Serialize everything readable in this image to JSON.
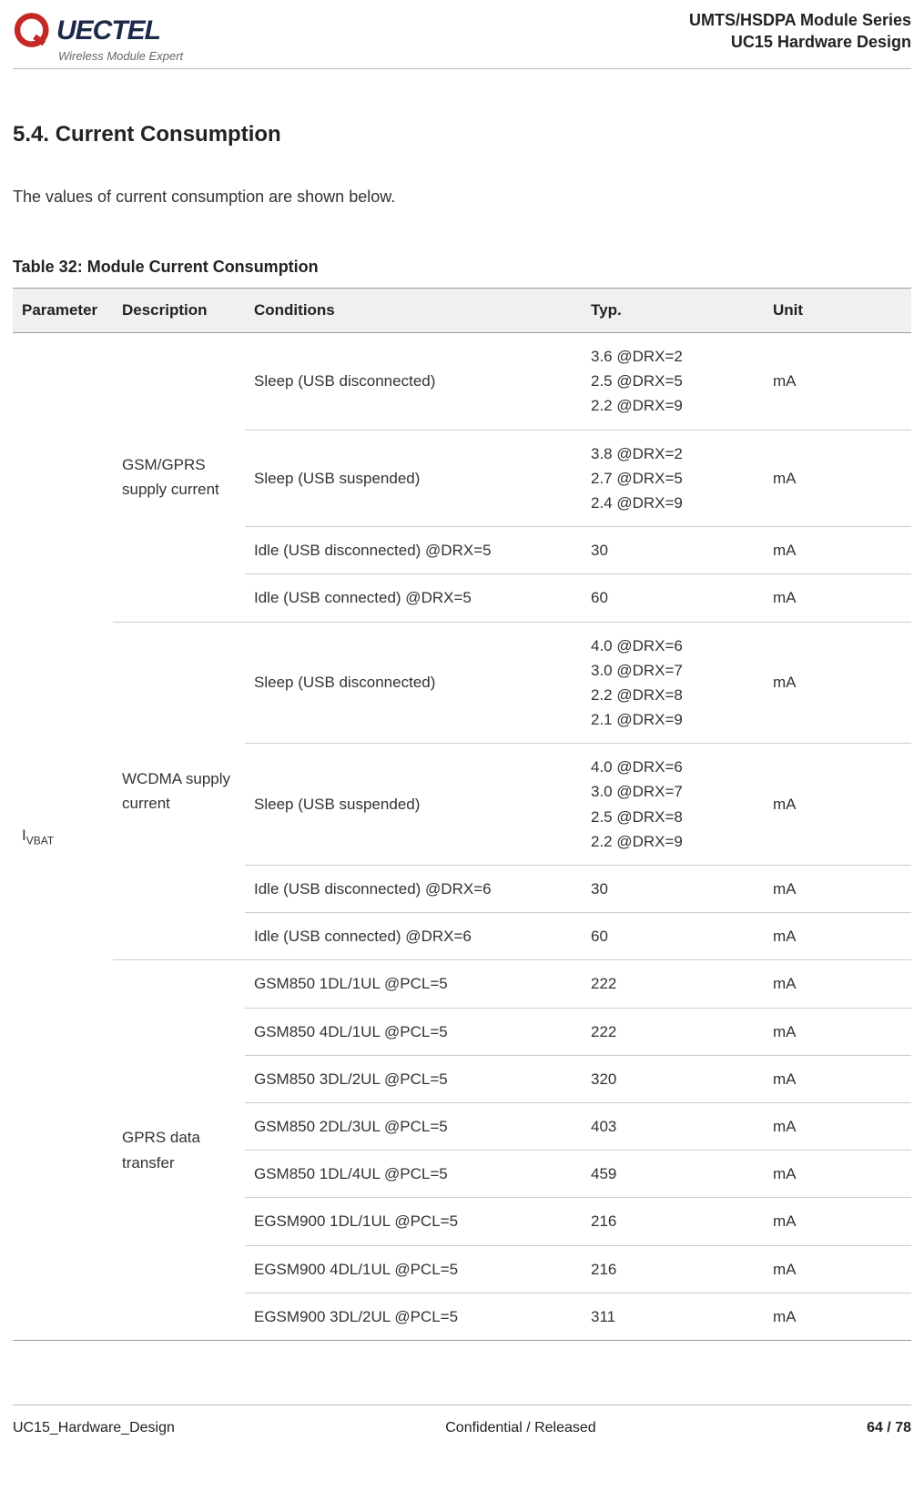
{
  "header": {
    "logo_text": "UECTEL",
    "logo_sub": "Wireless Module Expert",
    "series_line1": "UMTS/HSDPA Module Series",
    "series_line2": "UC15 Hardware Design"
  },
  "section": {
    "number_title": "5.4. Current Consumption",
    "intro": "The values of current consumption are shown below.",
    "table_caption": "Table 32: Module Current Consumption"
  },
  "table": {
    "headers": {
      "parameter": "Parameter",
      "description": "Description",
      "conditions": "Conditions",
      "typ": "Typ.",
      "unit": "Unit"
    },
    "parameter_base": "I",
    "parameter_sub": "VBAT",
    "groups": [
      {
        "description": "GSM/GPRS supply current",
        "rows": [
          {
            "conditions": "Sleep (USB disconnected)",
            "typ": [
              "3.6 @DRX=2",
              "2.5 @DRX=5",
              "2.2 @DRX=9"
            ],
            "unit": "mA"
          },
          {
            "conditions": "Sleep (USB suspended)",
            "typ": [
              "3.8 @DRX=2",
              "2.7 @DRX=5",
              "2.4 @DRX=9"
            ],
            "unit": "mA"
          },
          {
            "conditions": "Idle (USB disconnected) @DRX=5",
            "typ": [
              "30"
            ],
            "unit": "mA"
          },
          {
            "conditions": "Idle (USB connected) @DRX=5",
            "typ": [
              "60"
            ],
            "unit": "mA"
          }
        ]
      },
      {
        "description": "WCDMA supply current",
        "rows": [
          {
            "conditions": "Sleep (USB disconnected)",
            "typ": [
              "4.0 @DRX=6",
              "3.0 @DRX=7",
              "2.2 @DRX=8",
              "2.1 @DRX=9"
            ],
            "unit": "mA"
          },
          {
            "conditions": "Sleep (USB suspended)",
            "typ": [
              "4.0 @DRX=6",
              "3.0 @DRX=7",
              "2.5 @DRX=8",
              "2.2 @DRX=9"
            ],
            "unit": "mA"
          },
          {
            "conditions": "Idle (USB disconnected) @DRX=6",
            "typ": [
              "30"
            ],
            "unit": "mA"
          },
          {
            "conditions": "Idle (USB connected) @DRX=6",
            "typ": [
              "60"
            ],
            "unit": "mA"
          }
        ]
      },
      {
        "description": "GPRS data transfer",
        "rows": [
          {
            "conditions": "GSM850 1DL/1UL @PCL=5",
            "typ": [
              "222"
            ],
            "unit": "mA"
          },
          {
            "conditions": "GSM850 4DL/1UL @PCL=5",
            "typ": [
              "222"
            ],
            "unit": "mA"
          },
          {
            "conditions": "GSM850 3DL/2UL @PCL=5",
            "typ": [
              "320"
            ],
            "unit": "mA"
          },
          {
            "conditions": "GSM850 2DL/3UL @PCL=5",
            "typ": [
              "403"
            ],
            "unit": "mA"
          },
          {
            "conditions": "GSM850 1DL/4UL @PCL=5",
            "typ": [
              "459"
            ],
            "unit": "mA"
          },
          {
            "conditions": "EGSM900 1DL/1UL @PCL=5",
            "typ": [
              "216"
            ],
            "unit": "mA"
          },
          {
            "conditions": "EGSM900 4DL/1UL @PCL=5",
            "typ": [
              "216"
            ],
            "unit": "mA"
          },
          {
            "conditions": "EGSM900 3DL/2UL @PCL=5",
            "typ": [
              "311"
            ],
            "unit": "mA"
          }
        ]
      }
    ]
  },
  "footer": {
    "left": "UC15_Hardware_Design",
    "center": "Confidential / Released",
    "right": "64 / 78"
  }
}
